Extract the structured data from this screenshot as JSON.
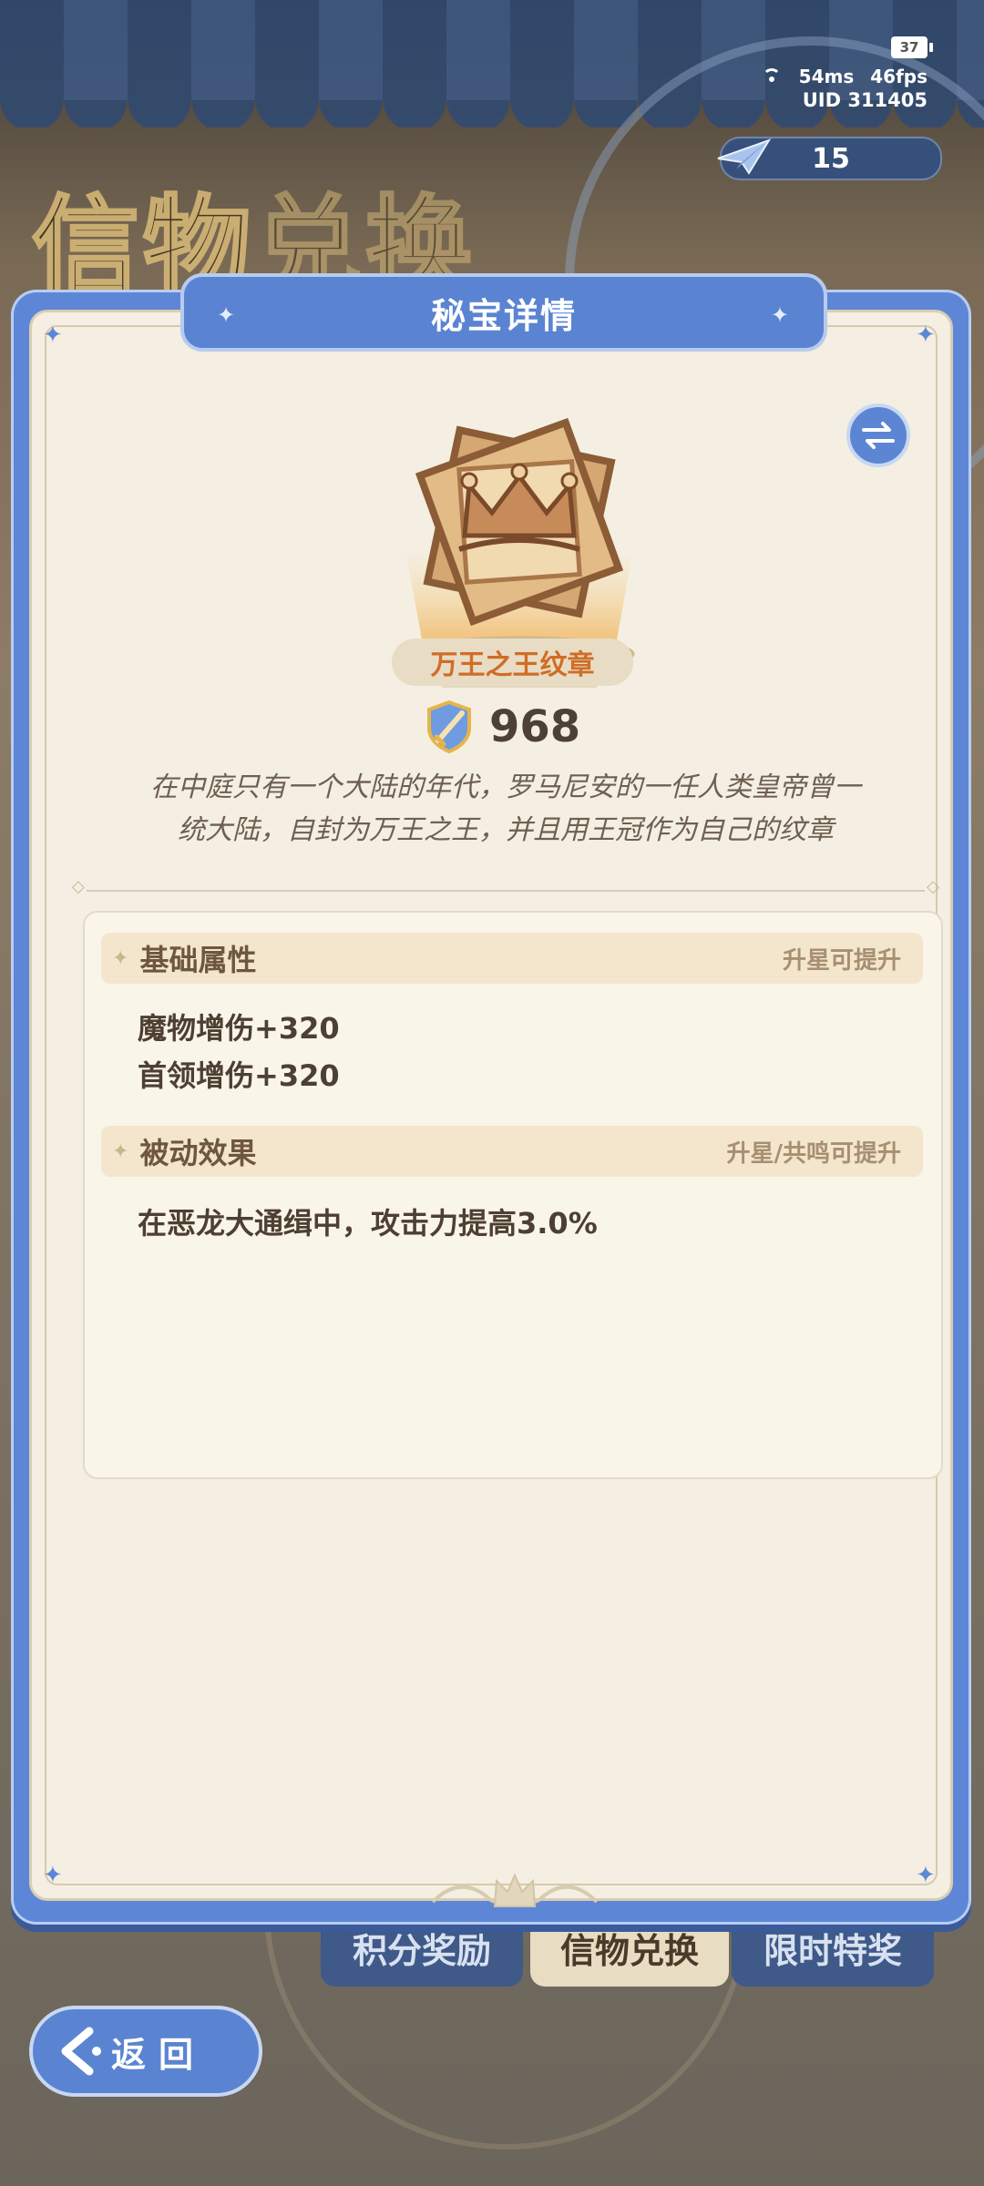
{
  "background": {
    "title_part1": "信物",
    "title_part2": "兑换",
    "tabs": [
      "积分奖励",
      "信物兑换",
      "限时特奖"
    ]
  },
  "status": {
    "battery": "37",
    "ping": "54ms",
    "fps": "46fps",
    "uid": "UID 311405"
  },
  "currency": {
    "icon": "paper-plane-icon",
    "amount": "15"
  },
  "modal": {
    "title": "秘宝详情",
    "item": {
      "name": "万王之王纹章",
      "power": "968",
      "description_line1": "在中庭只有一个大陆的年代，罗马尼安的一任人类皇帝曾一",
      "description_line2": "统大陆，自封为万王之王，并且用王冠作为自己的纹章"
    },
    "sections": {
      "base": {
        "title": "基础属性",
        "hint": "升星可提升",
        "stats": [
          "魔物增伤+320",
          "首领增伤+320"
        ]
      },
      "passive": {
        "title": "被动效果",
        "hint": "升星/共鸣可提升",
        "stats": [
          "在恶龙大通缉中，攻击力提高3.0%"
        ]
      }
    }
  },
  "back_button": {
    "label": "返回"
  },
  "colors": {
    "accent_blue": "#5a84d2",
    "parchment": "#f4efe2",
    "name_orange": "#d06d26",
    "text_brown": "#4d3f31"
  }
}
